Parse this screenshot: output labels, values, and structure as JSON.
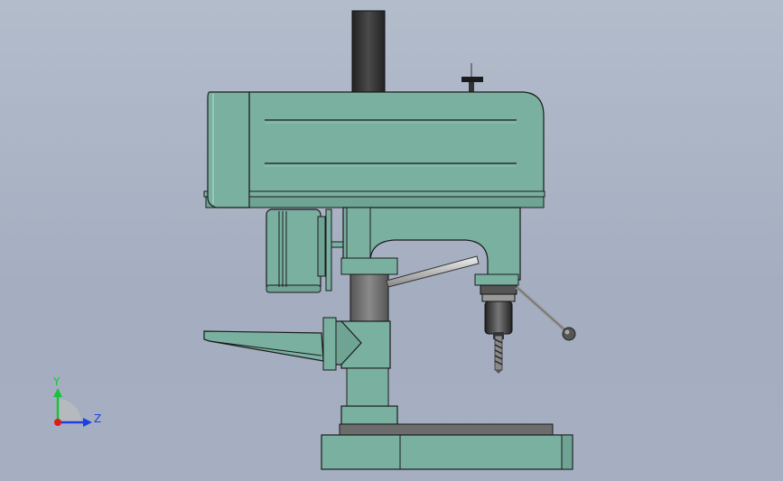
{
  "viewport": {
    "background_top": "#b3bccb",
    "background_bottom": "#a4aec0"
  },
  "model": {
    "body_color": "#7ab0a0",
    "body_shadow": "#5e9283",
    "edge_color": "#1b1b1b",
    "column_color": "#6c6c6c",
    "pillar_color": "#333333"
  },
  "triad": {
    "y_label": "Y",
    "z_label": "Z",
    "y_color": "#19c23a",
    "z_color": "#1f3fe0",
    "x_color": "#e01919"
  }
}
